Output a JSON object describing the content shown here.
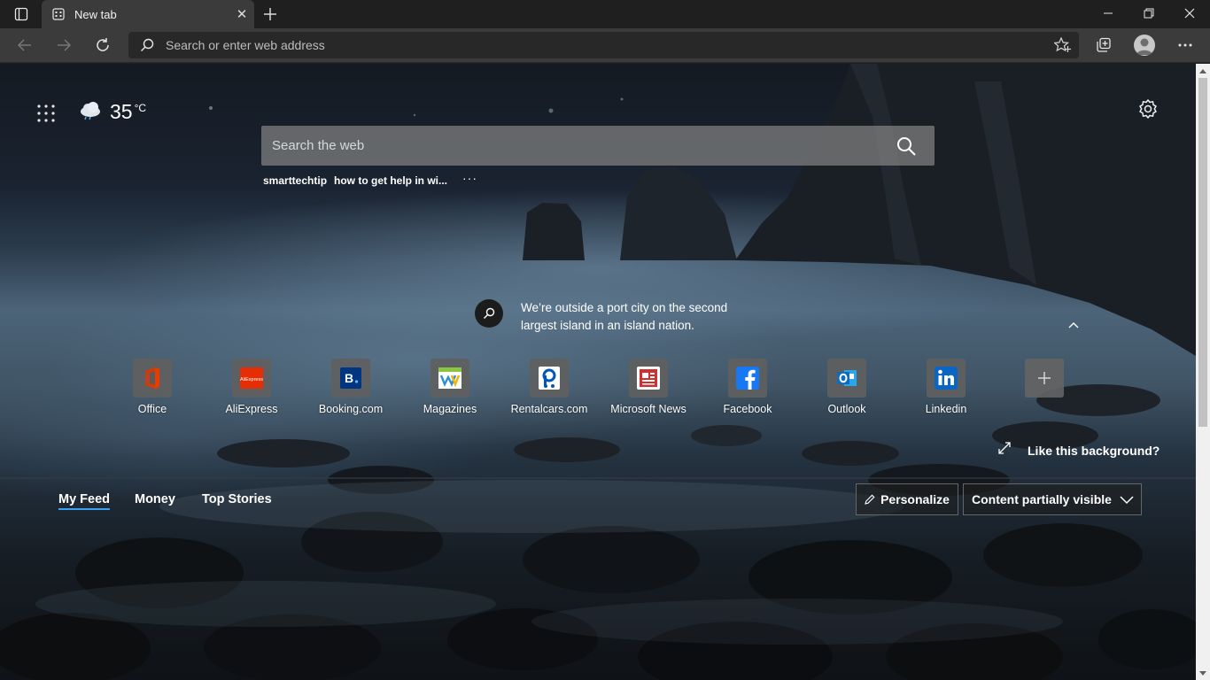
{
  "tab": {
    "title": "New tab"
  },
  "toolbar": {
    "address_placeholder": "Search or enter web address"
  },
  "weather": {
    "temp": "35",
    "unit": "°C",
    "icon": "cloud-icon"
  },
  "search": {
    "placeholder": "Search the web",
    "suggestions": [
      "smarttechtip",
      "how to get help in wi..."
    ],
    "more": "···"
  },
  "fact": {
    "text": "We’re outside a port city on the second largest island in an island nation."
  },
  "tiles": [
    {
      "label": "Office",
      "icon": "office-icon",
      "color": "#d83b01"
    },
    {
      "label": "AliExpress",
      "icon": "aliexpress-icon",
      "color": "#e62e04"
    },
    {
      "label": "Booking.com",
      "icon": "booking-icon",
      "color": "#003580"
    },
    {
      "label": "Magazines",
      "icon": "magazines-icon",
      "color": "#8cc63f"
    },
    {
      "label": "Rentalcars.com",
      "icon": "rentalcars-icon",
      "color": "#0057b8"
    },
    {
      "label": "Microsoft News",
      "icon": "news-icon",
      "color": "#d32f2f"
    },
    {
      "label": "Facebook",
      "icon": "facebook-icon",
      "color": "#1877f2"
    },
    {
      "label": "Outlook",
      "icon": "outlook-icon",
      "color": "#0f6cbd"
    },
    {
      "label": "Linkedin",
      "icon": "linkedin-icon",
      "color": "#0a66c2"
    }
  ],
  "background": {
    "like_label": "Like this background?"
  },
  "feed": {
    "tabs": [
      "My Feed",
      "Money",
      "Top Stories"
    ],
    "active_tab": "My Feed",
    "personalize_label": "Personalize",
    "visibility_label": "Content partially visible"
  },
  "colors": {
    "accent": "#3aa0f3",
    "tab_active": "#3b3b3b",
    "toolbar": "#3b3b3b"
  }
}
